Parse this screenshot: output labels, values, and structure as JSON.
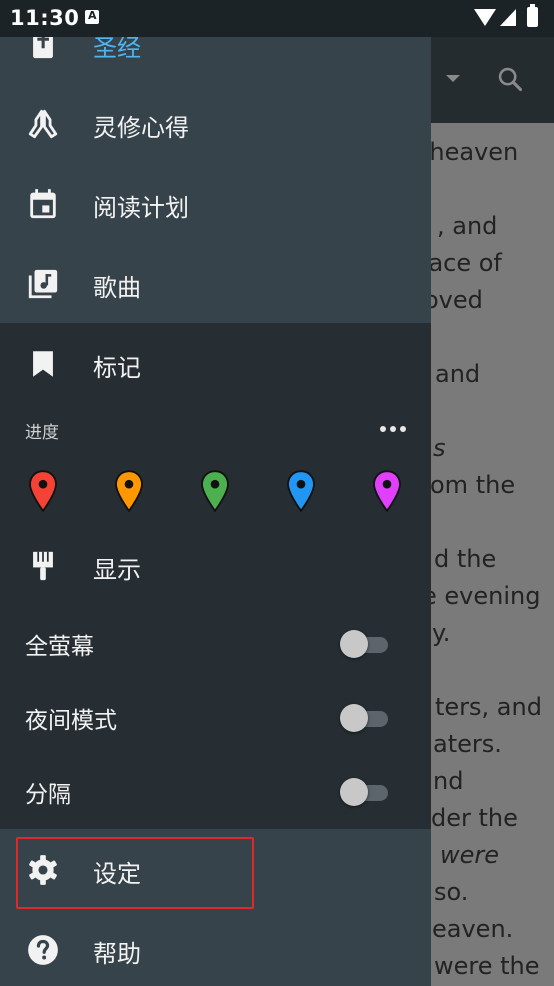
{
  "status_bar": {
    "time": "11:30"
  },
  "background_text": [
    "e heaven",
    ", and",
    "face of",
    "oved",
    "and",
    "s",
    "om the",
    "d the",
    "e evening",
    "y.",
    "ters, and",
    "aters.",
    "nd",
    "der the",
    "were",
    "so.",
    "eaven.",
    "were the"
  ],
  "drawer": {
    "items_top": [
      {
        "label": "圣经",
        "icon": "bible-icon",
        "active": true
      },
      {
        "label": "灵修心得",
        "icon": "praying-hands-icon"
      },
      {
        "label": "阅读计划",
        "icon": "calendar-icon"
      },
      {
        "label": "歌曲",
        "icon": "music-library-icon"
      }
    ],
    "bookmarks_label": "标记",
    "progress_label": "进度",
    "pins": [
      {
        "name": "red",
        "color": "#f44336"
      },
      {
        "name": "orange",
        "color": "#ff9800"
      },
      {
        "name": "green",
        "color": "#4caf50"
      },
      {
        "name": "blue",
        "color": "#2196f3"
      },
      {
        "name": "magenta",
        "color": "#e040fb"
      }
    ],
    "display_label": "显示",
    "toggles": [
      {
        "label": "全萤幕",
        "on": false
      },
      {
        "label": "夜间模式",
        "on": false
      },
      {
        "label": "分隔",
        "on": false
      }
    ],
    "settings_label": "设定",
    "help_label": "帮助"
  },
  "colors": {
    "accent": "#4fb4f0",
    "highlight_box": "#e02a2a"
  }
}
